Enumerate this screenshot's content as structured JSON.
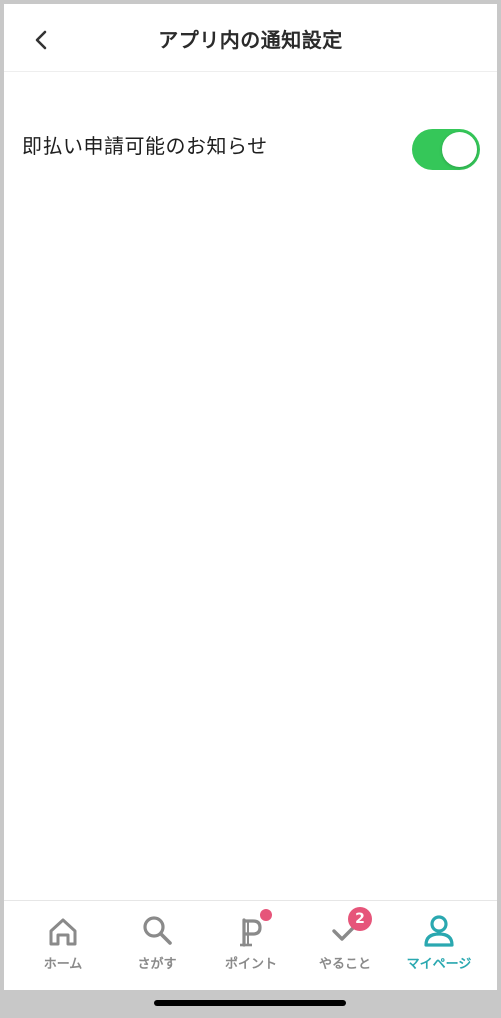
{
  "header": {
    "title": "アプリ内の通知設定",
    "back_icon": "chevron-left-icon"
  },
  "settings": [
    {
      "label": "即払い申請可能のお知らせ",
      "enabled": true,
      "toggle_color": "#35c759"
    }
  ],
  "tabbar": {
    "active_color": "#2aa8b0",
    "inactive_color": "#8a8a8a",
    "badge_color": "#e6557a",
    "tabs": [
      {
        "label": "ホーム",
        "icon": "home-icon",
        "active": false
      },
      {
        "label": "さがす",
        "icon": "search-icon",
        "active": false
      },
      {
        "label": "ポイント",
        "icon": "points-icon",
        "active": false,
        "dot_badge": true
      },
      {
        "label": "やること",
        "icon": "checkmark-icon",
        "active": false,
        "badge_count": "2"
      },
      {
        "label": "マイページ",
        "icon": "person-icon",
        "active": true
      }
    ]
  }
}
